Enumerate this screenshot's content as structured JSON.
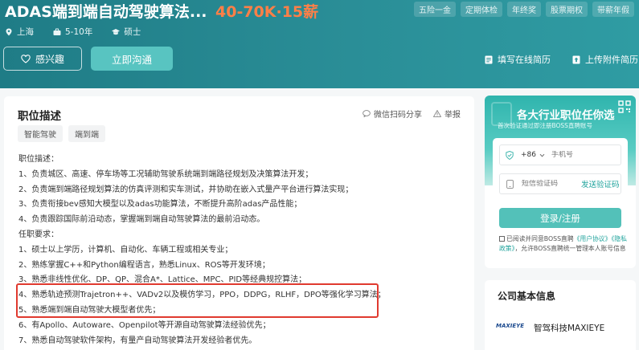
{
  "header": {
    "job_title": "ADAS端到端自动驾驶算法...",
    "salary": "40-70K·15薪",
    "benefit_tags": [
      "五险一金",
      "定期体检",
      "年终奖",
      "股票期权",
      "带薪年假"
    ],
    "location": "上海",
    "experience": "5-10年",
    "degree": "硕士",
    "interest_label": "感兴趣",
    "chat_label": "立即沟通",
    "online_resume_label": "填写在线简历",
    "upload_resume_label": "上传附件简历"
  },
  "job": {
    "section_title": "职位描述",
    "share_label": "微信扫码分享",
    "report_label": "举报",
    "keywords": [
      "智能驾驶",
      "端到端"
    ],
    "description_lines": [
      "职位描述：",
      "1、负责城区、高速、停车场等工况辅助驾驶系统端到端路径规划及决策算法开发；",
      "2、负责端到端路径规划算法的仿真评测和实车测试，并协助在嵌入式量产平台进行算法实现；",
      "3、负责衔接bev感知大模型以及adas功能算法，不断提升高阶adas产品性能；",
      "4、负责跟踪国际前沿动态，掌握端到端自动驾驶算法的最前沿动态。",
      "任职要求：",
      "1、硕士以上学历，计算机、自动化、车辆工程或相关专业；",
      "2、熟练掌握C++和Python编程语言，熟悉Linux、ROS等开发环境；",
      "3、熟悉非线性优化、DP、QP、混合A*、Lattice、MPC、PID等经典规控算法；",
      "4、熟悉轨迹预测Trajetron++、VADv2以及模仿学习，PPO，DDPG，RLHF，DPO等强化学习算法；",
      "5、熟悉端到端自动驾驶大模型者优先；",
      "6、有Apollo、Autoware、Openpilot等开源自动驾驶算法经验优先；",
      "7、熟悉自动驾驶软件架构，有量产自动驾驶算法开发经验者优先。"
    ]
  },
  "login": {
    "title": "各大行业职位任你选",
    "subtitle": "首次验证通过即注册BOSS直聘账号",
    "country_code": "+86",
    "phone_placeholder": "手机号",
    "code_placeholder": "短信验证码",
    "send_code_label": "发送验证码",
    "submit_label": "登录/注册",
    "agree_prefix": "已阅读并同意BOSS直聘",
    "user_agreement": "《用户协议》",
    "privacy_policy": "《隐私政策》",
    "agree_suffix": "，允许BOSS直聘统一管理本人账号信息"
  },
  "company": {
    "section_title": "公司基本信息",
    "logo_text": "MAXIEYE",
    "name": "智驾科技MAXIEYE"
  },
  "colors": {
    "header_bg": "#1f7c86",
    "salary": "#ff7f47",
    "accent": "#53c1b9",
    "highlight": "#e03a2f"
  }
}
